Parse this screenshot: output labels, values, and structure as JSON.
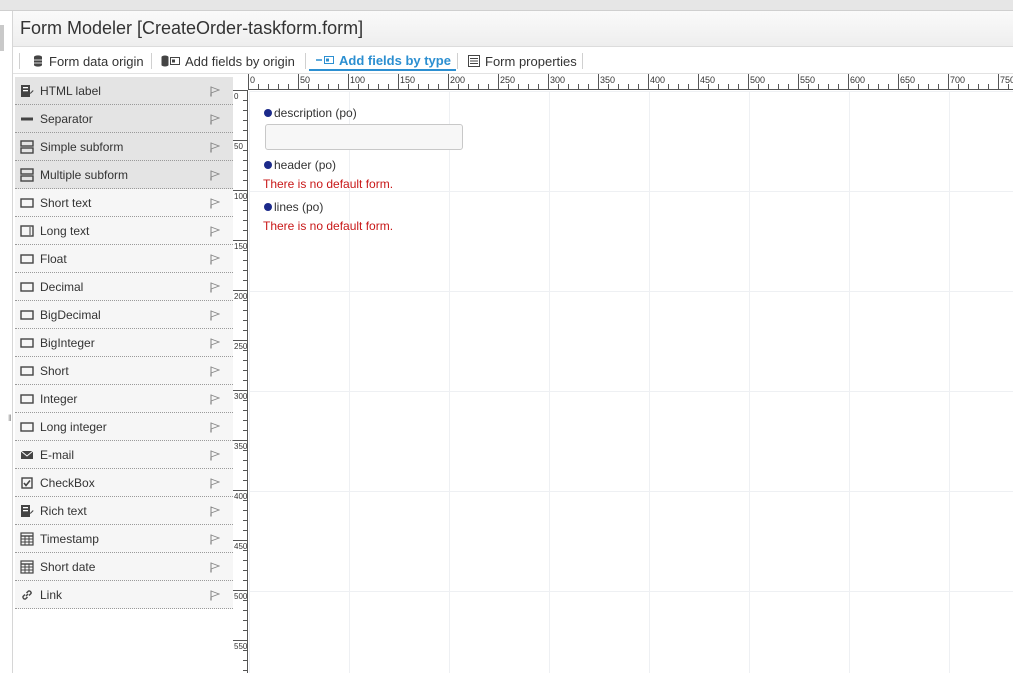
{
  "window": {
    "title": "Form Modeler [CreateOrder-taskform.form]"
  },
  "toolbar": {
    "buttons": [
      {
        "label": "Form data origin",
        "icon": "database-icon"
      },
      {
        "label": "Add fields by origin",
        "icon": "fields-origin-icon"
      },
      {
        "label": "Add fields by type",
        "icon": "fields-type-icon",
        "active": true
      },
      {
        "label": "Form properties",
        "icon": "properties-icon"
      }
    ],
    "accent_color": "#2c8fd1"
  },
  "palette": {
    "items": [
      {
        "label": "HTML label",
        "icon": "html-label-icon",
        "group": "grey"
      },
      {
        "label": "Separator",
        "icon": "separator-icon",
        "group": "grey"
      },
      {
        "label": "Simple subform",
        "icon": "subform-icon",
        "group": "grey"
      },
      {
        "label": "Multiple subform",
        "icon": "subform-icon",
        "group": "grey"
      },
      {
        "label": "Short text",
        "icon": "textbox-icon"
      },
      {
        "label": "Long text",
        "icon": "textarea-icon"
      },
      {
        "label": "Float",
        "icon": "textbox-icon"
      },
      {
        "label": "Decimal",
        "icon": "textbox-icon"
      },
      {
        "label": "BigDecimal",
        "icon": "textbox-icon"
      },
      {
        "label": "BigInteger",
        "icon": "textbox-icon"
      },
      {
        "label": "Short",
        "icon": "textbox-icon"
      },
      {
        "label": "Integer",
        "icon": "textbox-icon"
      },
      {
        "label": "Long integer",
        "icon": "textbox-icon"
      },
      {
        "label": "E-mail",
        "icon": "email-icon"
      },
      {
        "label": "CheckBox",
        "icon": "checkbox-icon"
      },
      {
        "label": "Rich text",
        "icon": "rich-text-icon"
      },
      {
        "label": "Timestamp",
        "icon": "calendar-icon"
      },
      {
        "label": "Short date",
        "icon": "calendar-icon"
      },
      {
        "label": "Link",
        "icon": "link-icon"
      }
    ]
  },
  "ruler": {
    "top_ticks": [
      "0",
      "50",
      "100",
      "150",
      "200",
      "250",
      "300",
      "350",
      "400",
      "450",
      "500",
      "550",
      "600",
      "650",
      "700",
      "750"
    ],
    "left_ticks": [
      "0",
      "50",
      "100",
      "150",
      "200",
      "250",
      "300",
      "350",
      "400",
      "450",
      "500",
      "550"
    ]
  },
  "form": {
    "fields": [
      {
        "label": "description (po)",
        "type": "input"
      },
      {
        "label": "header (po)",
        "type": "subform",
        "message": "There is no default form."
      },
      {
        "label": "lines (po)",
        "type": "subform",
        "message": "There is no default form."
      }
    ],
    "field_dot_color": "#1b2a8a",
    "error_color": "#c81818"
  }
}
